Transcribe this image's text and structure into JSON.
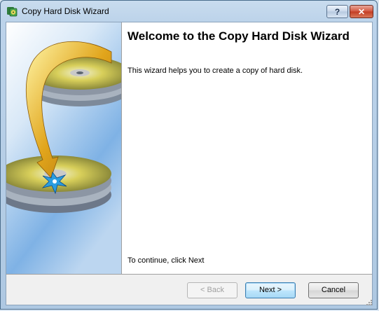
{
  "window": {
    "title": "Copy Hard Disk Wizard",
    "help_label": "?",
    "close_label": "✕"
  },
  "content": {
    "heading": "Welcome to the Copy Hard Disk Wizard",
    "description": "This wizard helps you to create a copy of hard disk.",
    "continue_text": "To continue, click Next"
  },
  "buttons": {
    "back": "< Back",
    "next": "Next >",
    "cancel": "Cancel"
  },
  "icons": {
    "app": "copy-disk-icon",
    "banner": "disk-copy-illustration",
    "grip": "resize-grip-icon"
  },
  "colors": {
    "accent": "#3c7fb1",
    "close": "#c23b22",
    "banner_sky": "#7fb2e5"
  }
}
